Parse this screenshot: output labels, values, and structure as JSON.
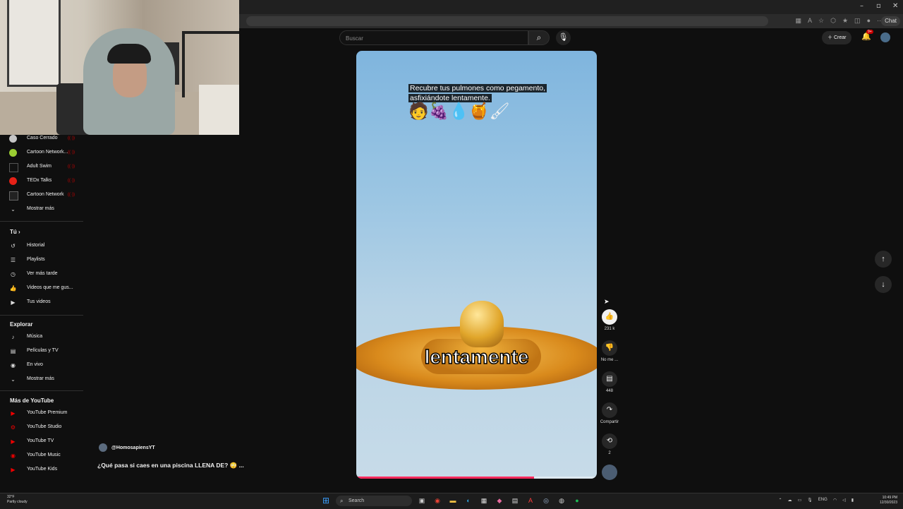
{
  "browser": {
    "window_controls": [
      "–",
      "▫",
      "✕"
    ],
    "chat_label": "Chat"
  },
  "header": {
    "search_placeholder": "Buscar",
    "create_label": "Crear",
    "notifications_badge": "9+"
  },
  "sidebar": {
    "subscriptions": [
      {
        "label": "Caso Cerrado",
        "icon": "channel-avatar"
      },
      {
        "label": "Cartoon Network...",
        "icon": "channel-avatar"
      },
      {
        "label": "Adult Swim",
        "icon": "channel-avatar"
      },
      {
        "label": "TEDx Talks",
        "icon": "channel-avatar"
      },
      {
        "label": "Cartoon Network",
        "icon": "channel-avatar"
      }
    ],
    "show_more_1": "Mostrar más",
    "you_heading": "Tú",
    "you_items": [
      {
        "label": "Historial",
        "icon": "history-icon"
      },
      {
        "label": "Playlists",
        "icon": "playlist-icon"
      },
      {
        "label": "Ver más tarde",
        "icon": "clock-icon"
      },
      {
        "label": "Videos que me gus...",
        "icon": "thumbs-up-icon"
      },
      {
        "label": "Tus videos",
        "icon": "play-square-icon"
      }
    ],
    "explore_heading": "Explorar",
    "explore_items": [
      {
        "label": "Música",
        "icon": "music-icon"
      },
      {
        "label": "Películas y TV",
        "icon": "film-icon"
      },
      {
        "label": "En vivo",
        "icon": "live-icon"
      }
    ],
    "show_more_2": "Mostrar más",
    "more_heading": "Más de YouTube",
    "more_items": [
      {
        "label": "YouTube Premium",
        "icon": "youtube-icon"
      },
      {
        "label": "YouTube Studio",
        "icon": "youtube-studio-icon"
      },
      {
        "label": "YouTube TV",
        "icon": "youtube-icon"
      },
      {
        "label": "YouTube Music",
        "icon": "youtube-music-icon"
      },
      {
        "label": "YouTube Kids",
        "icon": "youtube-kids-icon"
      }
    ]
  },
  "short": {
    "caption_line1": "Recubre tus pulmones como pegamento,",
    "caption_line2": "asfixiándote lentamente.",
    "emojis": "🧑🍇💧🍯🖌",
    "overlay_word": "lentamente",
    "progress": 0.74,
    "channel": "@HomosapiensYT",
    "title": "¿Qué pasa si caes en una piscina LLENA DE? 😳 ..."
  },
  "actions": {
    "like_count": "231 k",
    "dislike_label": "No me ...",
    "comments_count": "448",
    "share_label": "Compartir",
    "remix_count": "2"
  },
  "taskbar": {
    "weather_temp": "32°F",
    "weather_text": "Partly cloudy",
    "search_label": "Search",
    "lang": "ENG",
    "time": "10:49 PM",
    "date": "12/30/2023"
  }
}
